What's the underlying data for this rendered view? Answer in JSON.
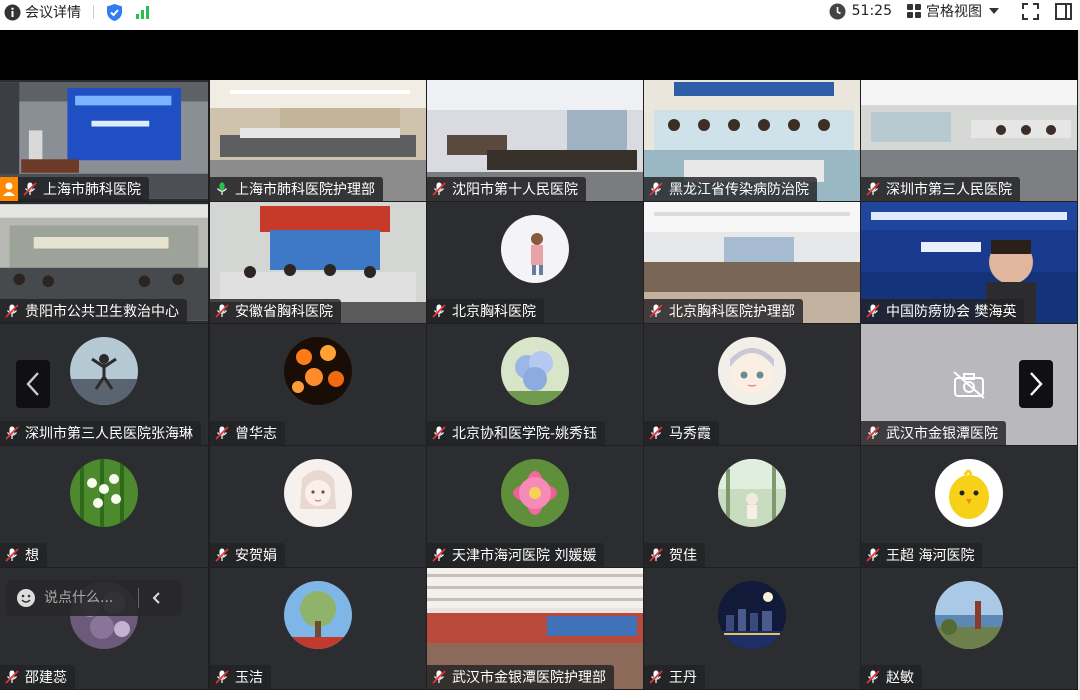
{
  "topbar": {
    "meeting_details": "会议详情",
    "timer": "51:25",
    "view_mode": "宫格视图"
  },
  "chat": {
    "placeholder": "说点什么..."
  },
  "tiles": [
    {
      "name": "上海市肺科医院",
      "type": "video",
      "scene": "hall-screen"
    },
    {
      "name": "上海市肺科医院护理部",
      "type": "video",
      "scene": "conference-room",
      "mic": "active"
    },
    {
      "name": "沈阳市第十人民医院",
      "type": "video",
      "scene": "office-room"
    },
    {
      "name": "黑龙江省传染病防治院",
      "type": "video",
      "scene": "staff-group"
    },
    {
      "name": "深圳市第三人民医院",
      "type": "video",
      "scene": "training-room"
    },
    {
      "name": "贵阳市公共卫生救治中心",
      "type": "video",
      "scene": "hall-people"
    },
    {
      "name": "安徽省胸科医院",
      "type": "video",
      "scene": "banner-room"
    },
    {
      "name": "北京胸科医院",
      "type": "avatar",
      "avatar": "girl"
    },
    {
      "name": "北京胸科医院护理部",
      "type": "video",
      "scene": "large-hall"
    },
    {
      "name": "中国防痨协会 樊海英",
      "type": "video",
      "scene": "slide-speaker"
    },
    {
      "name": "深圳市第三人民医院张海琳",
      "type": "avatar",
      "avatar": "jumper"
    },
    {
      "name": "曾华志",
      "type": "avatar",
      "avatar": "lanterns"
    },
    {
      "name": "北京协和医学院-姚秀钰",
      "type": "avatar",
      "avatar": "hydrangea"
    },
    {
      "name": "马秀霞",
      "type": "avatar",
      "avatar": "anime"
    },
    {
      "name": "武汉市金银潭医院",
      "type": "camera-off"
    },
    {
      "name": "想",
      "type": "avatar",
      "avatar": "lily"
    },
    {
      "name": "安贺娟",
      "type": "avatar",
      "avatar": "sketch"
    },
    {
      "name": "天津市海河医院  刘媛媛",
      "type": "avatar",
      "avatar": "lotus"
    },
    {
      "name": "贺佳",
      "type": "avatar",
      "avatar": "forest"
    },
    {
      "name": "王超 海河医院",
      "type": "avatar",
      "avatar": "chick"
    },
    {
      "name": "邵建蕊",
      "type": "avatar",
      "avatar": "purple"
    },
    {
      "name": "玉洁",
      "type": "avatar",
      "avatar": "tree"
    },
    {
      "name": "武汉市金银潭医院护理部",
      "type": "video",
      "scene": "ceiling-hall"
    },
    {
      "name": "王丹",
      "type": "avatar",
      "avatar": "night-city"
    },
    {
      "name": "赵敏",
      "type": "avatar",
      "avatar": "coast"
    }
  ],
  "colors": {
    "active_speaker": "#27c24c",
    "signal": "#27c24c",
    "shield": "#2f7cf6",
    "mic_muted": "#e0333a"
  }
}
